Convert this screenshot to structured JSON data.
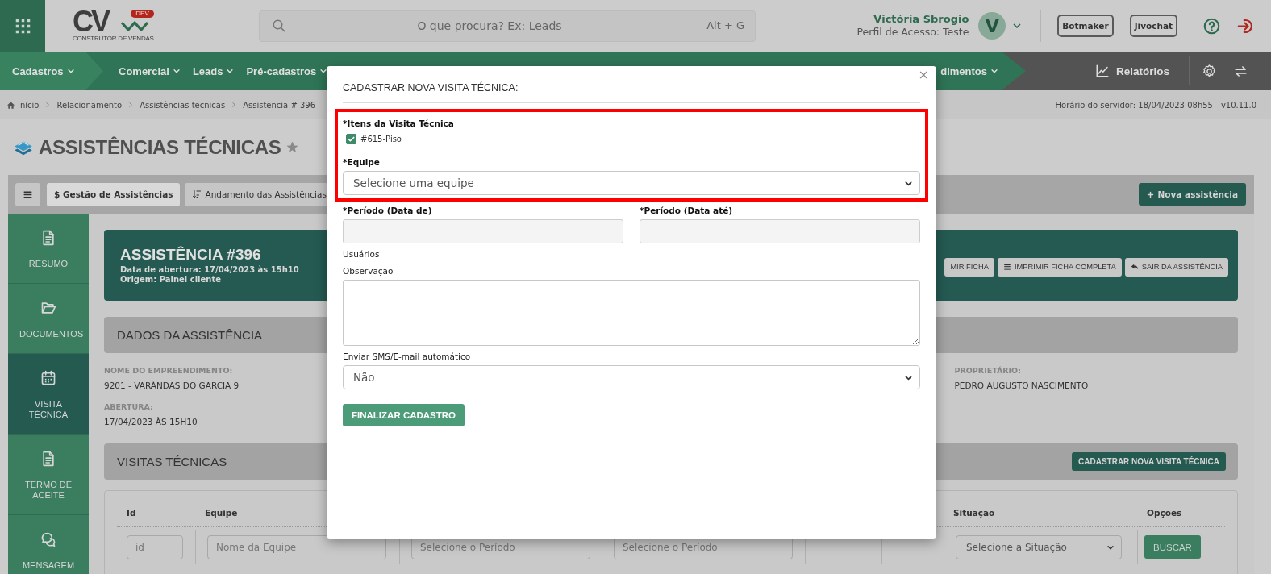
{
  "topbar": {
    "logo": {
      "letters": "CV",
      "badge": "DEV",
      "tagline": "CONSTRUTOR DE VENDAS"
    },
    "search": {
      "placeholder": "O que procura? Ex: Leads",
      "shortcut": "Alt + G"
    },
    "user": {
      "name": "Victória Sbrogio",
      "profile": "Perfil de Acesso: Teste",
      "initial": "V"
    },
    "buttons": [
      "Botmaker",
      "Jivochat"
    ]
  },
  "nav": {
    "items": [
      {
        "label": "Cadastros",
        "selected": true
      },
      {
        "label": "Comercial",
        "selected": false
      },
      {
        "label": "Leads",
        "selected": false
      },
      {
        "label": "Pré-cadastros",
        "selected": false
      },
      {
        "label": "dimentos",
        "selected": false
      }
    ],
    "reports": "Relatórios"
  },
  "breadcrumb": {
    "items": [
      "Início",
      "Relacionamento",
      "Assistências técnicas",
      "Assistência # 396"
    ],
    "server_time": "Horário do servidor: 18/04/2023 08h55 - v10.11.0"
  },
  "page": {
    "title": "ASSISTÊNCIAS TÉCNICAS",
    "favorite": false
  },
  "toolbar": {
    "tabs": [
      {
        "label": "$ Gestão de Assistências",
        "selected": true
      },
      {
        "label": "Andamento das Assistências",
        "selected": false
      }
    ],
    "new_button": "Nova assistência"
  },
  "sidebar": [
    {
      "label": "RESUMO",
      "kind": "file",
      "selected": false
    },
    {
      "label": "DOCUMENTOS",
      "kind": "folder",
      "selected": false
    },
    {
      "label": "VISITA TÉCNICA",
      "kind": "calendar",
      "selected": true
    },
    {
      "label": "TERMO DE ACEITE",
      "kind": "file",
      "selected": false
    },
    {
      "label": "MENSAGEM",
      "kind": "chat",
      "selected": false
    }
  ],
  "assistance": {
    "title": "ASSISTÊNCIA #396",
    "opened": "Data de abertura: 17/04/2023 às 15h10",
    "origin": "Origem: Painel cliente",
    "actions": [
      {
        "label": "MIR FICHA",
        "kind": "plain"
      },
      {
        "label": "IMPRIMIR FICHA COMPLETA",
        "kind": "list"
      },
      {
        "label": "SAIR DA ASSISTÊNCIA",
        "kind": "reply"
      }
    ]
  },
  "details": {
    "title": "DADOS DA ASSISTÊNCIA",
    "rows": [
      [
        {
          "label": "NOME DO EMPREENDIMENTO:",
          "value": "9201 - VARÁNDÃS DO GARCIA 9"
        },
        null,
        null,
        {
          "label": "PROPRIETÁRIO:",
          "value": "PEDRO AUGUSTO NASCIMENTO"
        }
      ],
      [
        {
          "label": "ABERTURA:",
          "value": "17/04/2023 ÀS 15H10"
        }
      ]
    ]
  },
  "visits": {
    "title": "VISITAS TÉCNICAS",
    "add_button": "CADASTRAR NOVA VISITA TÉCNICA",
    "columns": [
      {
        "label": "Id"
      },
      {
        "label": "Equipe"
      },
      {},
      {},
      {},
      {},
      {
        "label": "Situação"
      },
      {
        "label": "Opções"
      }
    ],
    "filters": [
      {
        "kind": "input",
        "placeholder": "id"
      },
      {
        "kind": "input",
        "placeholder": "Nome da Equipe"
      },
      {
        "kind": "input",
        "placeholder": "Selecione o Período"
      },
      {
        "kind": "input",
        "placeholder": "Selecione o Período"
      },
      {
        "kind": "empty"
      },
      {
        "kind": "empty"
      },
      {
        "kind": "select",
        "value": "Selecione a Situação"
      },
      {
        "kind": "button",
        "label": "BUSCAR"
      }
    ]
  },
  "modal": {
    "title": "CADASTRAR NOVA VISITA TÉCNICA:",
    "close": "×",
    "sections": [
      {
        "kind": "highlight",
        "fields": [
          {
            "kind": "checklist",
            "label": "*Itens da Visita Técnica",
            "required": true,
            "items": [
              {
                "label": "#615-Piso",
                "checked": true
              }
            ]
          },
          {
            "kind": "select",
            "label": "*Equipe",
            "required": true,
            "value": "Selecione uma equipe"
          }
        ]
      },
      {
        "kind": "plain",
        "fields": [
          {
            "kind": "date_pair",
            "fields": [
              {
                "label": "*Período (Data de)",
                "required": true
              },
              {
                "label": "*Período (Data até)",
                "required": true
              }
            ]
          },
          {
            "kind": "text",
            "label": "Usuários",
            "required": false
          },
          {
            "kind": "textarea",
            "label": "Observação",
            "required": false
          },
          {
            "kind": "select",
            "label": "Enviar SMS/E-mail automático",
            "required": false,
            "value": "Não"
          }
        ]
      }
    ],
    "submit": "FINALIZAR CADASTRO"
  }
}
